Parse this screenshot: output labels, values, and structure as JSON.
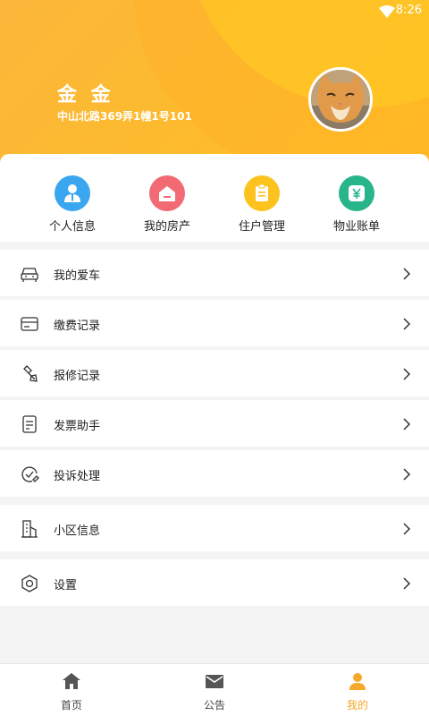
{
  "status_bar": {
    "time": "8:26"
  },
  "profile": {
    "name": "金 金",
    "address": "中山北路369弄1幢1号101"
  },
  "shortcuts": [
    {
      "label": "个人信息",
      "icon": "person-icon",
      "color": "#3aa6f0"
    },
    {
      "label": "我的房产",
      "icon": "house-icon",
      "color": "#f26a73"
    },
    {
      "label": "住户管理",
      "icon": "clipboard-icon",
      "color": "#fcc21e"
    },
    {
      "label": "物业账单",
      "icon": "yen-icon",
      "color": "#28b58a"
    }
  ],
  "menu": [
    {
      "label": "我的爱车",
      "icon": "car-icon"
    },
    {
      "label": "缴费记录",
      "icon": "card-icon"
    },
    {
      "label": "报修记录",
      "icon": "repair-brush-icon"
    },
    {
      "label": "发票助手",
      "icon": "invoice-icon"
    },
    {
      "label": "投诉处理",
      "icon": "complaint-icon"
    },
    {
      "label": "小区信息",
      "icon": "building-icon"
    },
    {
      "label": "设置",
      "icon": "settings-icon"
    }
  ],
  "tabs": [
    {
      "label": "首页",
      "icon": "home-icon"
    },
    {
      "label": "公告",
      "icon": "mail-icon"
    },
    {
      "label": "我的",
      "icon": "user-icon"
    }
  ],
  "active_tab": "我的",
  "colors": {
    "brand": "#fdbb2d",
    "active": "#f5a82a"
  }
}
